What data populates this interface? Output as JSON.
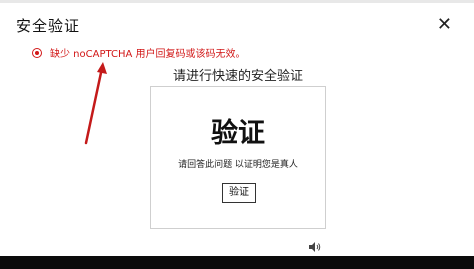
{
  "dialog": {
    "title": "安全验证",
    "close_glyph": "✕",
    "error_message": "缺少 noCAPTCHA 用户回复码或该码无效。",
    "subtitle": "请进行快速的安全验证"
  },
  "captcha": {
    "heading": "验证",
    "description": "请回答此问题 以证明您是真人",
    "button_label": "验证"
  },
  "icons": {
    "error": "error-circle-icon",
    "audio": "speaker-icon",
    "annotation": "red-arrow-annotation"
  },
  "colors": {
    "error": "#d21818",
    "arrow": "#c41a1a"
  }
}
